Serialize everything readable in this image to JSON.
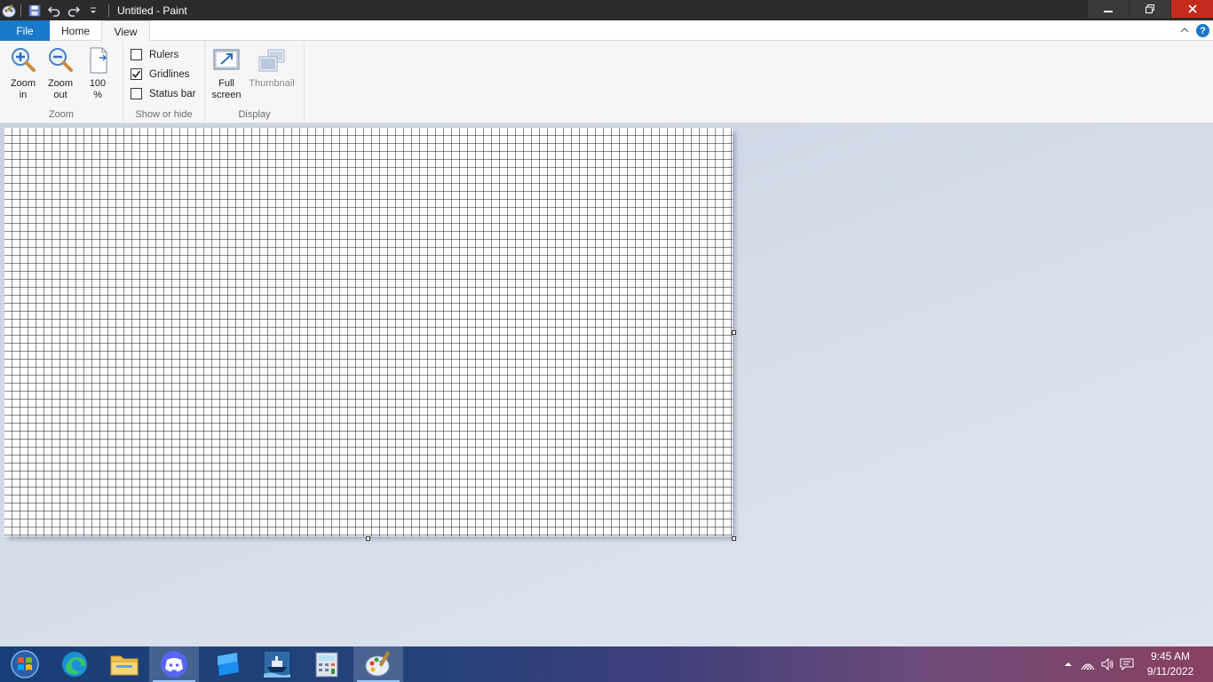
{
  "window": {
    "title": "Untitled - Paint"
  },
  "tabs": {
    "file": "File",
    "home": "Home",
    "view": "View"
  },
  "ribbon": {
    "zoom": {
      "label": "Zoom",
      "zoom_in_line1": "Zoom",
      "zoom_in_line2": "in",
      "zoom_out_line1": "Zoom",
      "zoom_out_line2": "out",
      "hundred_line1": "100",
      "hundred_line2": "%"
    },
    "show_hide": {
      "label": "Show or hide",
      "rulers": "Rulers",
      "rulers_checked": false,
      "gridlines": "Gridlines",
      "gridlines_checked": true,
      "status_bar": "Status bar",
      "status_bar_checked": false
    },
    "display": {
      "label": "Display",
      "full_screen_line1": "Full",
      "full_screen_line2": "screen",
      "thumbnail": "Thumbnail"
    }
  },
  "colors": {
    "accent": "#1979ca",
    "titlebar": "#2b2b2b",
    "close": "#c42b1c",
    "ribbon_bg": "#f5f6f7"
  },
  "taskbar": {
    "apps": [
      "start-orb-icon",
      "edge-icon",
      "file-explorer-icon",
      "discord-icon",
      "roblox-studio-icon",
      "ship-game-icon",
      "calculator-icon",
      "paint-icon"
    ],
    "clock_time": "9:45 AM",
    "clock_date": "9/11/2022"
  }
}
